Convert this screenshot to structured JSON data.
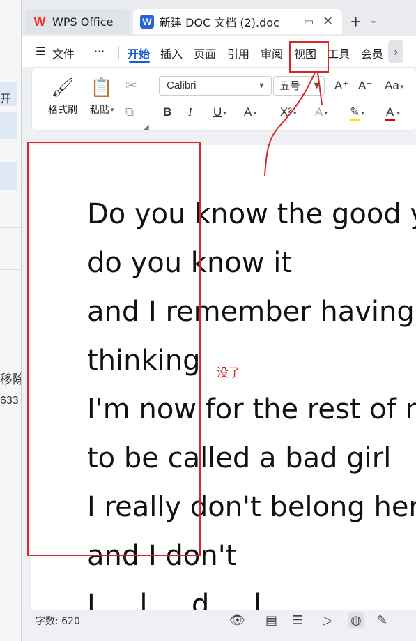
{
  "background_app": {
    "text_fragments": [
      "开",
      "移除",
      "633"
    ]
  },
  "tabs": {
    "wps_tab": "WPS Office",
    "doc_tab": "新建 DOC 文档 (2).doc"
  },
  "ribbon": {
    "file_label": "文件",
    "more_label": "···",
    "tabs": [
      "开始",
      "插入",
      "页面",
      "引用",
      "审阅",
      "视图",
      "工具",
      "会员"
    ],
    "active_tab": "开始"
  },
  "toolbar": {
    "format_painter": "格式刷",
    "paste": "粘贴",
    "font_name": "Calibri",
    "font_size": "五号",
    "bold": "B",
    "italic": "I",
    "underline": "U",
    "strike": "A",
    "superscript": "X²",
    "grow": "A⁺",
    "shrink": "A⁻",
    "case": "Aa",
    "highlight_color": "#f5e400",
    "font_color": "#d0021b"
  },
  "document": {
    "lines": [
      "Do you know the good yo",
      "do you know it",
      "and  I  remember  having",
      "thinking",
      "I'm now for the rest of m",
      "to be called a bad girl",
      "I really don't belong here",
      "and I don't",
      "I  ...  l  ...  d  ...  l"
    ]
  },
  "status": {
    "word_count": "字数: 620"
  },
  "annotations": {
    "note": "没了",
    "color": "#d9262b"
  }
}
